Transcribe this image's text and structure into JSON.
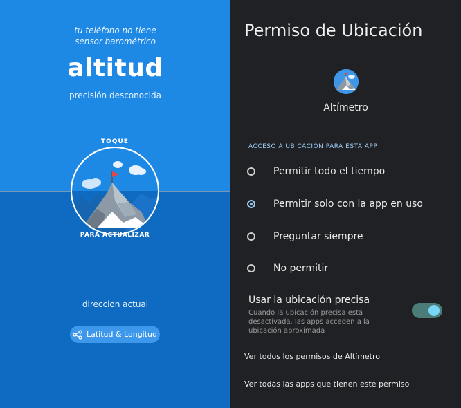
{
  "left_panel": {
    "sensor_line1": "tu teléfono no tiene",
    "sensor_line2": "sensor barométrico",
    "altitude_value": "altitud",
    "precision": "precisión desconocida",
    "tap_top": "TOQUE",
    "tap_bottom": "PARA ACTUALIZAR",
    "address": "direccion actual",
    "latlng_button": "Latitud & Longitud",
    "latlng_icon": "share-icon",
    "colors": {
      "top": "#1e88e5",
      "bottom": "#0f6bc2"
    }
  },
  "permission_dialog": {
    "title": "Permiso de Ubicación",
    "app_name": "Altímetro",
    "app_icon": "mountain-icon",
    "section_label": "ACCESO A UBICACIÓN PARA ESTA APP",
    "options": [
      {
        "label": "Permitir todo el tiempo",
        "selected": false
      },
      {
        "label": "Permitir solo con la app en uso",
        "selected": true
      },
      {
        "label": "Preguntar siempre",
        "selected": false
      },
      {
        "label": "No permitir",
        "selected": false
      }
    ],
    "precise_title": "Usar la ubicación precisa",
    "precise_desc": "Cuando la ubicación precisa está desactivada, las apps acceden a la ubicación aproximada",
    "precise_enabled": true,
    "link_all_permissions": "Ver todos los permisos de Altímetro",
    "link_all_apps": "Ver todas las apps que tienen este permiso"
  }
}
